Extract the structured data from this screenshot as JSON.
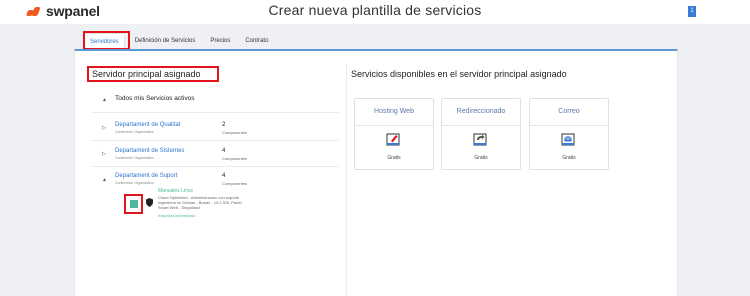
{
  "app": {
    "logo_text": "swpanel",
    "title": "Crear nueva plantilla de servicios",
    "badge": "1"
  },
  "tabs": [
    {
      "label": "Servidores",
      "active": true
    },
    {
      "label": "Definición de Servicios",
      "active": false
    },
    {
      "label": "Precios",
      "active": false
    },
    {
      "label": "Contrato",
      "active": false
    }
  ],
  "left": {
    "heading": "Servidor principal asignado",
    "all_services": "Todos mis Servicios activos",
    "departments": [
      {
        "name": "Departament de Qualitat",
        "sub": "Contenedor Organizativo",
        "count": "2",
        "count_label": "Componentes"
      },
      {
        "name": "Departament de Sistemes",
        "sub": "Contenedor Organizativo",
        "count": "4",
        "count_label": "Componentes"
      },
      {
        "name": "Departament de Suport",
        "sub": "Contenedor Organizativo",
        "count": "4",
        "count_label": "Componentes"
      }
    ],
    "service": {
      "name": "Manuales Linux",
      "description": "Cloud Optimized - Administración con soporte Ingeniería en Debian - Buster - 10.2 SSL Panel Smart Web - Seguridad",
      "tag": "Seguridad Administrada"
    }
  },
  "right": {
    "heading": "Servicios disponibles en el servidor principal asignado",
    "cards": [
      {
        "title": "Hosting Web",
        "icon": "document-edit-icon",
        "price": "Gratis"
      },
      {
        "title": "Redireccionado",
        "icon": "redirect-icon",
        "price": "Gratis"
      },
      {
        "title": "Correo",
        "icon": "mail-icon",
        "price": "Gratis"
      }
    ]
  },
  "colors": {
    "accent": "#2e75c9",
    "highlight": "#e2141b",
    "brand": "#f05a22",
    "success": "#4fb89c"
  }
}
